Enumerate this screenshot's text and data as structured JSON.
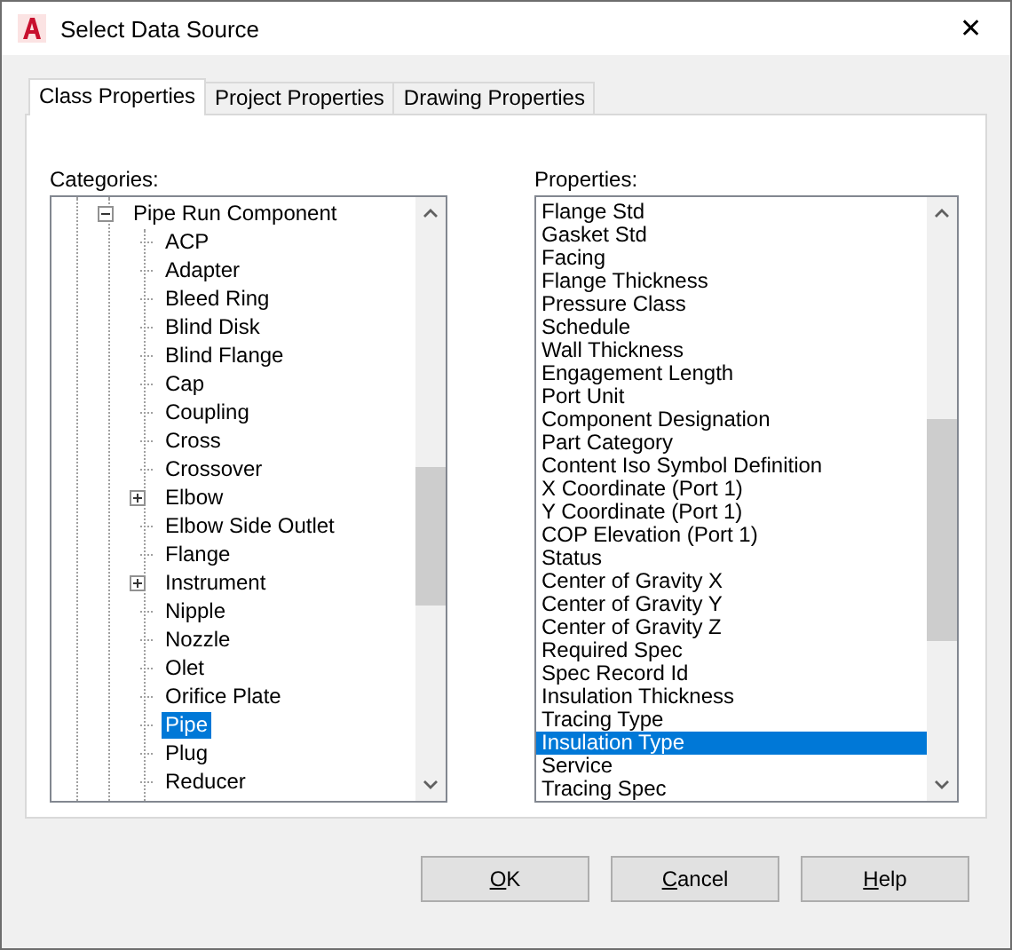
{
  "window": {
    "title": "Select Data Source",
    "close": "✕"
  },
  "tabs": [
    {
      "label": "Class Properties",
      "selected": true
    },
    {
      "label": "Project Properties",
      "selected": false
    },
    {
      "label": "Drawing Properties",
      "selected": false
    }
  ],
  "categories": {
    "label": "Categories:",
    "items": [
      {
        "label": "Pipe Run Component",
        "expanded": true,
        "selected": false,
        "children": [
          {
            "label": "ACP",
            "selected": false
          },
          {
            "label": "Adapter",
            "selected": false
          },
          {
            "label": "Bleed Ring",
            "selected": false
          },
          {
            "label": "Blind Disk",
            "selected": false
          },
          {
            "label": "Blind Flange",
            "selected": false
          },
          {
            "label": "Cap",
            "selected": false
          },
          {
            "label": "Coupling",
            "selected": false
          },
          {
            "label": "Cross",
            "selected": false
          },
          {
            "label": "Crossover",
            "selected": false
          },
          {
            "label": "Elbow",
            "expanded": false,
            "selected": false
          },
          {
            "label": "Elbow Side Outlet",
            "selected": false
          },
          {
            "label": "Flange",
            "selected": false
          },
          {
            "label": "Instrument",
            "expanded": false,
            "selected": false
          },
          {
            "label": "Nipple",
            "selected": false
          },
          {
            "label": "Nozzle",
            "selected": false
          },
          {
            "label": "Olet",
            "selected": false
          },
          {
            "label": "Orifice Plate",
            "selected": false
          },
          {
            "label": "Pipe",
            "selected": true
          },
          {
            "label": "Plug",
            "selected": false
          },
          {
            "label": "Reducer",
            "selected": false
          }
        ]
      }
    ]
  },
  "properties": {
    "label": "Properties:",
    "items": [
      {
        "label": "Flange Std",
        "selected": false
      },
      {
        "label": "Gasket Std",
        "selected": false
      },
      {
        "label": "Facing",
        "selected": false
      },
      {
        "label": "Flange Thickness",
        "selected": false
      },
      {
        "label": "Pressure Class",
        "selected": false
      },
      {
        "label": "Schedule",
        "selected": false
      },
      {
        "label": "Wall Thickness",
        "selected": false
      },
      {
        "label": "Engagement Length",
        "selected": false
      },
      {
        "label": "Port Unit",
        "selected": false
      },
      {
        "label": "Component Designation",
        "selected": false
      },
      {
        "label": "Part Category",
        "selected": false
      },
      {
        "label": "Content Iso Symbol Definition",
        "selected": false
      },
      {
        "label": "X Coordinate (Port 1)",
        "selected": false
      },
      {
        "label": "Y Coordinate (Port 1)",
        "selected": false
      },
      {
        "label": "COP Elevation (Port 1)",
        "selected": false
      },
      {
        "label": "Status",
        "selected": false
      },
      {
        "label": "Center of Gravity X",
        "selected": false
      },
      {
        "label": "Center of Gravity Y",
        "selected": false
      },
      {
        "label": "Center of Gravity Z",
        "selected": false
      },
      {
        "label": "Required Spec",
        "selected": false
      },
      {
        "label": "Spec Record Id",
        "selected": false
      },
      {
        "label": "Insulation Thickness",
        "selected": false
      },
      {
        "label": "Tracing Type",
        "selected": false
      },
      {
        "label": "Insulation Type",
        "selected": true
      },
      {
        "label": "Service",
        "selected": false
      },
      {
        "label": "Tracing Spec",
        "selected": false
      }
    ]
  },
  "buttons": [
    {
      "access_key": "O",
      "label_rest": "K"
    },
    {
      "access_key": "C",
      "label_rest": "ancel"
    },
    {
      "access_key": "H",
      "label_rest": "elp"
    }
  ]
}
